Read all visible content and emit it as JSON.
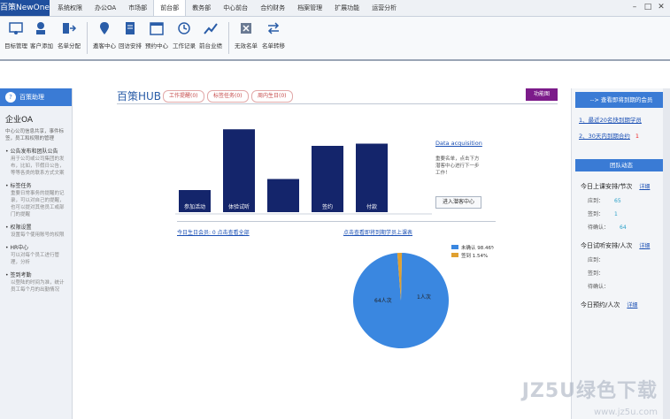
{
  "app": {
    "logo": "百策NewOne"
  },
  "top_menu": [
    "系统权限",
    "办公OA",
    "市场部",
    "前台部",
    "教务部",
    "中心前台",
    "合约财务",
    "档案管理",
    "扩展功能",
    "运营分析"
  ],
  "top_menu_active": "前台部",
  "toolbar": [
    {
      "label": "目标管理",
      "icon": "target-icon"
    },
    {
      "label": "客户添加",
      "icon": "add-customer-icon"
    },
    {
      "label": "名单分配",
      "icon": "assign-icon"
    },
    {
      "label": "邀客中心",
      "icon": "location-pin-icon"
    },
    {
      "label": "回访安排",
      "icon": "document-icon"
    },
    {
      "label": "预约中心",
      "icon": "calendar-icon"
    },
    {
      "label": "工作记录",
      "icon": "clock-icon"
    },
    {
      "label": "前台业绩",
      "icon": "chart-icon"
    },
    {
      "label": "无效名单",
      "icon": "invalid-list-icon"
    },
    {
      "label": "名单转移",
      "icon": "transfer-icon"
    }
  ],
  "left_panel": {
    "header": "百策助理",
    "title": "企业OA",
    "desc": "中心公司信息共享，事件标签，员工和权限的管理",
    "items": [
      {
        "label": "公告发布和团队公告",
        "sub": "用于公司或公司集团的发布，比如，节假日公告，等等各类的联系方式文案"
      },
      {
        "label": "标签任务",
        "sub": "重要日常事务的提醒的记录，可以对自己的提醒，也可以提对其他员工或部门的提醒"
      },
      {
        "label": "权限设置",
        "sub": "设置每个使用账号的权限"
      },
      {
        "label": "HR中心",
        "sub": "可以对每个员工进行管理，分析"
      },
      {
        "label": "签到考勤",
        "sub": "以登陆的时间为准，统计员工每个月的出勤情况"
      }
    ]
  },
  "main": {
    "title": "百策HUB",
    "tabs": [
      "工作提醒(0)",
      "标签任务(0)",
      "周内生日(0)"
    ],
    "func_button": "功能图",
    "bar_labels": [
      "参加活动",
      "体验试听",
      "",
      "签约",
      "付款"
    ],
    "bar_values": [
      20,
      75,
      30,
      60,
      62
    ],
    "data_link": "Data acquisition",
    "data_desc": "重要名单，点击下方潜客中心进行下一步工作！",
    "enter_button": "进入潜客中心",
    "link_left": "今日生日会员: 0  点击查看全部",
    "link_right": "点击查看即将到期学员上课表"
  },
  "chart_data": {
    "type": "pie",
    "slices": [
      {
        "name": "未确认 98.46%",
        "value": 98.46,
        "color": "#3a87e0",
        "label": "64人次"
      },
      {
        "name": "签到 1.54%",
        "value": 1.54,
        "color": "#e0a030",
        "label": "1人次"
      }
    ]
  },
  "right_panel": {
    "header": "--> 查看即将到期的会员",
    "links": [
      "1、最近20名快到期学员",
      "2、30天内到期合约"
    ],
    "link2_count": "1",
    "team_header": "团队动态",
    "sections": [
      {
        "title": "今日上课安排/节次",
        "link": "详细",
        "rows": [
          {
            "k": "应到：",
            "v": "65"
          },
          {
            "k": "签到：",
            "v": "1"
          },
          {
            "k": "待确认：",
            "v": "64"
          }
        ]
      },
      {
        "title": "今日试听安排/人次",
        "link": "详细",
        "rows": [
          {
            "k": "应到：",
            "v": ""
          },
          {
            "k": "签到：",
            "v": ""
          },
          {
            "k": "待确认：",
            "v": ""
          }
        ]
      },
      {
        "title": "今日预约/人次",
        "link": "详细",
        "rows": []
      }
    ]
  },
  "watermark": {
    "main": "JZ5U绿色下载",
    "sub": "www.jz5u.com"
  }
}
